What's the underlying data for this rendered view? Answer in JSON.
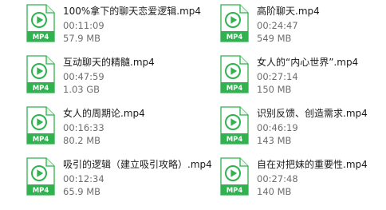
{
  "colors": {
    "icon_green": "#2fb24f",
    "icon_green_light": "#e7f6ea",
    "name_text": "#1a1a1a",
    "meta_text": "#6d6d6d"
  },
  "files": [
    {
      "name": "100%拿下的聊天恋爱逻辑.mp4",
      "duration": "00:11:09",
      "size": "57.9 MB",
      "badge": "MP4",
      "icon": "mp4-file-icon"
    },
    {
      "name": "高阶聊天.mp4",
      "duration": "00:24:47",
      "size": "549 MB",
      "badge": "MP4",
      "icon": "mp4-file-icon"
    },
    {
      "name": "互动聊天的精髓.mp4",
      "duration": "00:47:59",
      "size": "1.03 GB",
      "badge": "MP4",
      "icon": "mp4-file-icon"
    },
    {
      "name": "女人的“内心世界”.mp4",
      "duration": "00:27:14",
      "size": "150 MB",
      "badge": "MP4",
      "icon": "mp4-file-icon"
    },
    {
      "name": "女人的周期论.mp4",
      "duration": "00:16:33",
      "size": "80.2 MB",
      "badge": "MP4",
      "icon": "mp4-file-icon"
    },
    {
      "name": "识别反馈、创造需求.mp4",
      "duration": "00:46:19",
      "size": "143 MB",
      "badge": "MP4",
      "icon": "mp4-file-icon"
    },
    {
      "name": "吸引的逻辑（建立吸引攻略）.mp4",
      "duration": "00:12:34",
      "size": "65.9 MB",
      "badge": "MP4",
      "icon": "mp4-file-icon"
    },
    {
      "name": "自在对把妹的重要性.mp4",
      "duration": "00:27:48",
      "size": "140 MB",
      "badge": "MP4",
      "icon": "mp4-file-icon"
    }
  ]
}
